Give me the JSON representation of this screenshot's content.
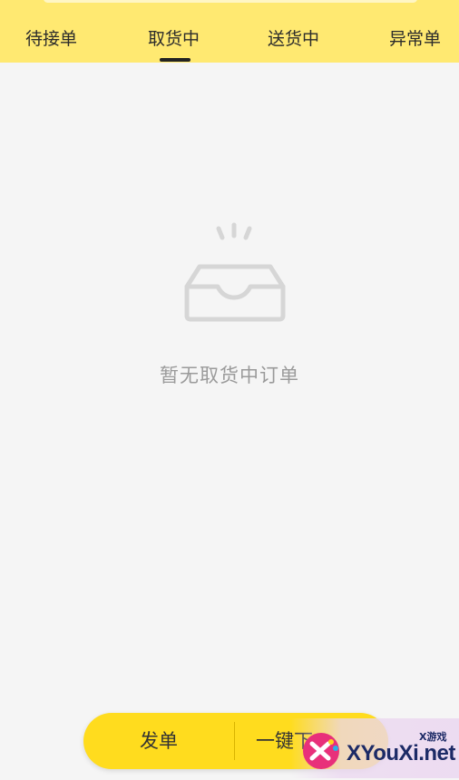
{
  "tabs": [
    {
      "label": "待接单",
      "active": false
    },
    {
      "label": "取货中",
      "active": true
    },
    {
      "label": "送货中",
      "active": false
    },
    {
      "label": "异常单",
      "active": false
    }
  ],
  "empty_state": {
    "icon": "empty-inbox-icon",
    "message": "暂无取货中订单"
  },
  "actions": {
    "dispatch_label": "发单",
    "one_click_label": "一键下"
  },
  "watermark": {
    "icon": "game-controller-logo",
    "brand": "XYouXi.net",
    "tag": "X游戏"
  },
  "colors": {
    "header_bg": "#ffe971",
    "accent": "#ffdc1e",
    "page_bg": "#f5f5f5",
    "empty_text": "#9a9a9a"
  }
}
